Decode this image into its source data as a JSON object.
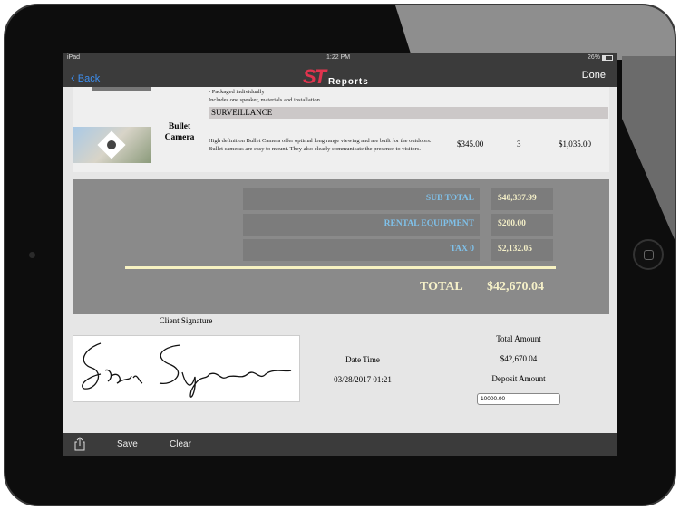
{
  "status": {
    "carrier": "iPad",
    "time": "1:22 PM",
    "battery": "26%"
  },
  "nav": {
    "back": "Back",
    "done": "Done",
    "logo_st": "ST",
    "logo_reports": "Reports"
  },
  "item_prev": {
    "desc_line1": "- Packaged individually",
    "desc_line2": "Includes one speaker, materials and installation."
  },
  "section": "SURVEILLANCE",
  "item": {
    "name_line1": "Bullet",
    "name_line2": "Camera",
    "desc_line1": "High definition Bullet Camera offer optimal long range viewing and are built for the outdoors.",
    "desc_line2": "Bullet cameras are easy to mount. They also clearly communicate the presence to visitors.",
    "price": "$345.00",
    "qty": "3",
    "total": "$1,035.00"
  },
  "summary": {
    "rows": [
      {
        "label": "SUB TOTAL",
        "value": "$40,337.99"
      },
      {
        "label": "RENTAL EQUIPMENT",
        "value": "$200.00"
      },
      {
        "label": "TAX 0",
        "value": "$2,132.05"
      }
    ],
    "total_label": "TOTAL",
    "total_value": "$42,670.04"
  },
  "signature": {
    "label": "Client Signature",
    "date_label": "Date Time",
    "date_value": "03/28/2017 01:21",
    "total_amount_label": "Total Amount",
    "total_amount_value": "$42,670.04",
    "deposit_label": "Deposit Amount",
    "deposit_value": "10000.00"
  },
  "toolbar": {
    "save": "Save",
    "clear": "Clear"
  }
}
